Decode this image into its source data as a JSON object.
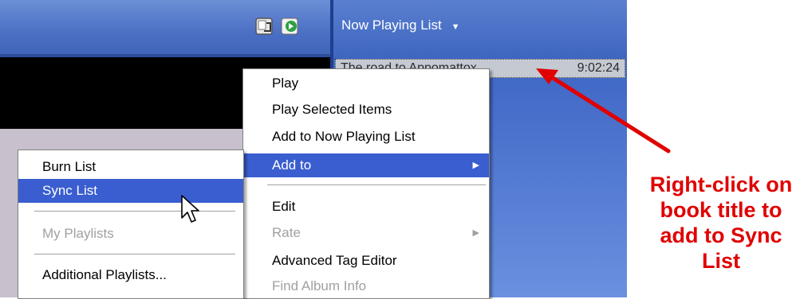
{
  "topbar": {
    "icons": [
      "switch-to-skin-icon",
      "switch-to-compact-icon"
    ]
  },
  "now_playing": {
    "title": "Now Playing List",
    "dropdown_glyph": "▼",
    "track": {
      "title": "The road to Appomattox",
      "duration": "9:02:24"
    }
  },
  "context_menu": {
    "items": [
      {
        "label": "Play"
      },
      {
        "label": "Play Selected Items"
      },
      {
        "label": "Add to Now Playing List"
      },
      {
        "label": "Add to",
        "submenu_glyph": "▶"
      },
      {
        "label": "Edit"
      },
      {
        "label": "Rate",
        "submenu_glyph": "▶"
      },
      {
        "label": "Advanced Tag Editor"
      },
      {
        "label": "Find Album Info"
      }
    ]
  },
  "submenu": {
    "items": [
      {
        "label": "Burn List"
      },
      {
        "label": "Sync List"
      },
      {
        "label": "My Playlists"
      },
      {
        "label": "Additional Playlists..."
      }
    ]
  },
  "annotation": {
    "lines": [
      "Right-click on",
      "book title to",
      "add to Sync",
      "List"
    ],
    "color": "#e00000"
  },
  "colors": {
    "selection": "#3a5ed0",
    "np_background": "#4a6fc8"
  }
}
